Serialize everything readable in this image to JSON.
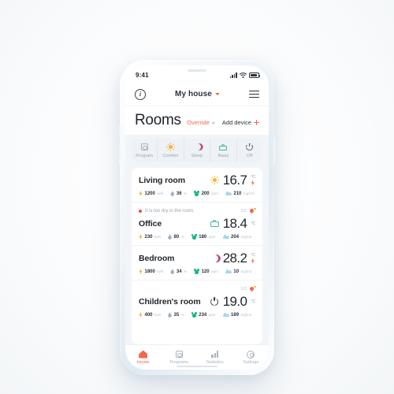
{
  "status_bar": {
    "time": "9:41",
    "signal_icon": "signal-bars-icon",
    "wifi_icon": "wifi-icon",
    "battery_icon": "battery-icon"
  },
  "app_bar": {
    "info_label": "i",
    "house_name": "My house",
    "info_icon": "info-circle-icon",
    "chevron_icon": "chevron-down-icon",
    "menu_icon": "hamburger-menu-icon"
  },
  "header": {
    "title": "Rooms",
    "override_label": "Override",
    "override_chevron": "chevron-up-icon",
    "add_device_label": "Add device",
    "add_device_icon": "plus-icon"
  },
  "modes": [
    {
      "label": "Program",
      "icon": "program-calendar-icon"
    },
    {
      "label": "Comfort",
      "icon": "sun-icon"
    },
    {
      "label": "Sleep",
      "icon": "moon-icon"
    },
    {
      "label": "Away",
      "icon": "briefcase-icon"
    },
    {
      "label": "Off",
      "icon": "power-icon"
    }
  ],
  "rooms": [
    {
      "name": "Living room",
      "mode_icon": "sun-icon",
      "temperature": "16.7",
      "unit": "°C",
      "flame_icon": "heating-bolt-icon",
      "warning": null,
      "metrics": [
        {
          "icon": "bolt-icon",
          "value": "1200",
          "unit": "kwh"
        },
        {
          "icon": "drop-icon",
          "value": "36",
          "unit": "%"
        },
        {
          "icon": "co2-icon",
          "value": "200",
          "unit": "ppm"
        },
        {
          "icon": "cloud-icon",
          "value": "210",
          "unit": "mg/m3"
        }
      ]
    },
    {
      "name": "Office",
      "mode_icon": "briefcase-icon",
      "temperature": "18.4",
      "unit": "°C",
      "flame_icon": null,
      "warning": {
        "text": "It is too dry in the room.",
        "count": "1/2",
        "dot_icon": "alert-dot-icon",
        "icon": "humidity-warning-icon"
      },
      "metrics": [
        {
          "icon": "bolt-icon",
          "value": "230",
          "unit": "kwh"
        },
        {
          "icon": "drop-icon",
          "value": "80",
          "unit": "%"
        },
        {
          "icon": "co2-icon",
          "value": "180",
          "unit": "ppm"
        },
        {
          "icon": "cloud-icon",
          "value": "204",
          "unit": "mg/m3"
        }
      ]
    },
    {
      "name": "Bedroom",
      "mode_icon": "moon-icon",
      "temperature": "28.2",
      "unit": "°C",
      "flame_icon": "heating-bolt-icon",
      "warning": null,
      "metrics": [
        {
          "icon": "bolt-icon",
          "value": "1800",
          "unit": "kwh"
        },
        {
          "icon": "drop-icon",
          "value": "34",
          "unit": "%"
        },
        {
          "icon": "co2-icon",
          "value": "120",
          "unit": "ppm"
        },
        {
          "icon": "cloud-icon",
          "value": "10",
          "unit": "mg/m3"
        }
      ]
    },
    {
      "name": "Children's room",
      "mode_icon": "power-icon",
      "temperature": "19.0",
      "unit": "°C",
      "flame_icon": null,
      "warning": {
        "text": "",
        "count": "1/2",
        "dot_icon": null,
        "icon": "humidity-warning-icon"
      },
      "metrics": [
        {
          "icon": "bolt-icon",
          "value": "400",
          "unit": "kwh"
        },
        {
          "icon": "drop-icon",
          "value": "35",
          "unit": "%"
        },
        {
          "icon": "co2-icon",
          "value": "234",
          "unit": "ppm"
        },
        {
          "icon": "cloud-icon",
          "value": "189",
          "unit": "mg/m3"
        }
      ]
    }
  ],
  "tabs": [
    {
      "label": "House",
      "icon": "house-icon",
      "active": true
    },
    {
      "label": "Programs",
      "icon": "programs-icon",
      "active": false
    },
    {
      "label": "Statistics",
      "icon": "statistics-icon",
      "active": false
    },
    {
      "label": "Settings",
      "icon": "settings-gear-icon",
      "active": false
    }
  ],
  "colors": {
    "accent": "#f2674a",
    "warm": "#f9b233",
    "green": "#3fbf9a",
    "purple": "#b0467e",
    "co2": "#17b88a",
    "cloud": "#a8d8ee",
    "alert": "#ee4d3d"
  }
}
